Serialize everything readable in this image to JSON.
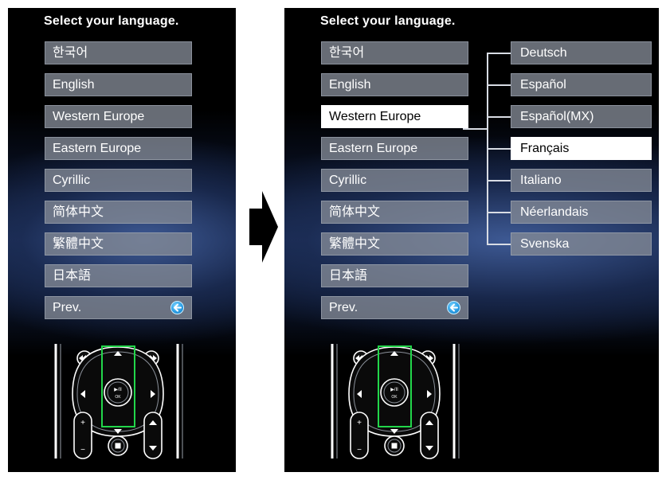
{
  "left_screen": {
    "title": "Select your language.",
    "languages": [
      "한국어",
      "English",
      "Western Europe",
      "Eastern Europe",
      "Cyrillic",
      "简体中文",
      "繁體中文",
      "日本語"
    ],
    "prev_label": "Prev."
  },
  "right_screen": {
    "title": "Select your language.",
    "languages": [
      "한국어",
      "English",
      "Western Europe",
      "Eastern Europe",
      "Cyrillic",
      "简体中文",
      "繁體中文",
      "日本語"
    ],
    "selected_language": "Western Europe",
    "prev_label": "Prev.",
    "submenu": [
      "Deutsch",
      "Español",
      "Español(MX)",
      "Français",
      "Italiano",
      "Néerlandais",
      "Svenska"
    ],
    "selected_submenu": "Français"
  },
  "remote": {
    "center_label_top": "▶/II",
    "center_label_bottom": "OK",
    "plus_label": "+",
    "minus_label": "−"
  },
  "colors": {
    "highlight": "#ffffff",
    "menu_item": "#848a96",
    "dpad_frame": "#22d64a",
    "back_icon": "#2a9ee6"
  }
}
